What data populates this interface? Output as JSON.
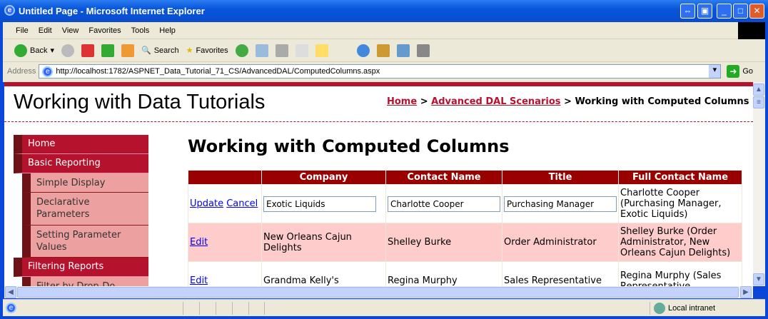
{
  "window": {
    "title": "Untitled Page - Microsoft Internet Explorer"
  },
  "menubar": [
    "File",
    "Edit",
    "View",
    "Favorites",
    "Tools",
    "Help"
  ],
  "toolbar": {
    "back": "Back",
    "search": "Search",
    "favorites": "Favorites"
  },
  "address": {
    "label": "Address",
    "url": "http://localhost:1782/ASPNET_Data_Tutorial_71_CS/AdvancedDAL/ComputedColumns.aspx",
    "go": "Go"
  },
  "site": {
    "title": "Working with Data Tutorials"
  },
  "breadcrumb": {
    "home": "Home",
    "section": "Advanced DAL Scenarios",
    "sep": ">",
    "current": "Working with Computed Columns"
  },
  "nav": {
    "home": "Home",
    "basic": "Basic Reporting",
    "simple": "Simple Display",
    "declarative": "Declarative Parameters",
    "setting": "Setting Parameter Values",
    "filtering": "Filtering Reports",
    "filter_sub": "Filter by Drop-Do"
  },
  "page": {
    "heading": "Working with Computed Columns"
  },
  "grid": {
    "headers": [
      "",
      "Company",
      "Contact Name",
      "Title",
      "Full Contact Name"
    ],
    "update": "Update",
    "cancel": "Cancel",
    "edit": "Edit",
    "edit_row": {
      "company": "Exotic Liquids",
      "contact": "Charlotte Cooper",
      "title": "Purchasing Manager",
      "full": "Charlotte Cooper (Purchasing Manager, Exotic Liquids)"
    },
    "rows": [
      {
        "company": "New Orleans Cajun Delights",
        "contact": "Shelley Burke",
        "title": "Order Administrator",
        "full": "Shelley Burke (Order Administrator, New Orleans Cajun Delights)"
      },
      {
        "company": "Grandma Kelly's",
        "contact": "Regina Murphy",
        "title": "Sales Representative",
        "full": "Regina Murphy (Sales Representative,"
      }
    ]
  },
  "status": {
    "zone": "Local intranet"
  }
}
